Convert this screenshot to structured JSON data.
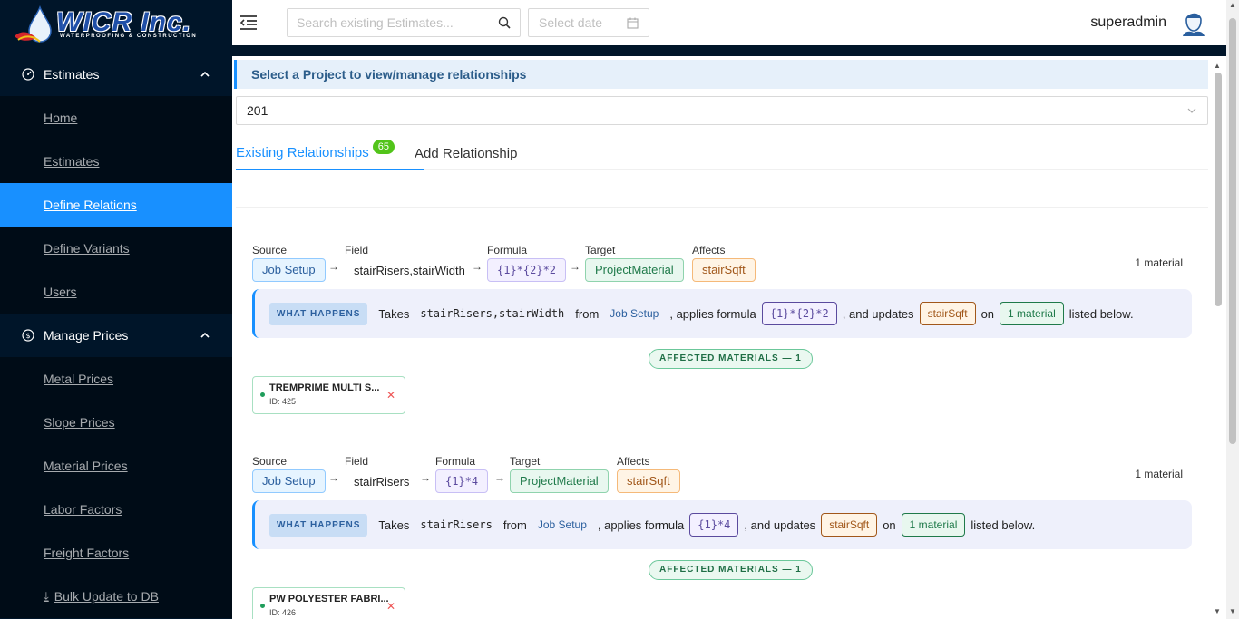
{
  "brand": {
    "logo_text": "WICR Inc.",
    "logo_sub": "WATERPROOFING & CONSTRUCTION"
  },
  "sidebar": {
    "groups": [
      {
        "label": "Estimates",
        "icon": "dashboard-icon",
        "items": [
          "Home",
          "Estimates",
          "Define Relations",
          "Define Variants",
          "Users"
        ]
      },
      {
        "label": "Manage Prices",
        "icon": "dollar-icon",
        "items": [
          "Metal Prices",
          "Slope Prices",
          "Material Prices",
          "Labor Factors",
          "Freight Factors",
          "Bulk Update to DB"
        ]
      }
    ],
    "active": "Define Relations"
  },
  "header": {
    "search_placeholder": "Search existing Estimates...",
    "date_placeholder": "Select date",
    "username": "superadmin"
  },
  "main": {
    "banner": "Select a Project to view/manage relationships",
    "project": "201",
    "tabs": {
      "existing": "Existing Relationships",
      "count": "65",
      "add": "Add Relationship"
    },
    "labels": {
      "source": "Source",
      "field": "Field",
      "formula": "Formula",
      "target": "Target",
      "affects": "Affects",
      "what_happens": "WHAT HAPPENS",
      "takes": "Takes",
      "from": "from",
      "applies": ", applies formula",
      "updates": ", and updates",
      "on": "on",
      "listed": "listed below."
    },
    "relationships": [
      {
        "source": "Job Setup",
        "field": "stairRisers,stairWidth",
        "formula": "{1}*{2}*2",
        "target": "ProjectMaterial",
        "affects": "stairSqft",
        "count": "1 material",
        "affected_label": "AFFECTED MATERIALS — 1",
        "material": {
          "name": "TREMPRIME MULTI S...",
          "id": "ID: 425"
        }
      },
      {
        "source": "Job Setup",
        "field": "stairRisers",
        "formula": "{1}*4",
        "target": "ProjectMaterial",
        "affects": "stairSqft",
        "count": "1 material",
        "affected_label": "AFFECTED MATERIALS — 1",
        "material": {
          "name": "PW POLYESTER FABRI...",
          "id": "ID: 426"
        }
      }
    ]
  },
  "colors": {
    "sidebar_bg": "#001529",
    "accent": "#1890ff",
    "badge_green": "#52c41a"
  }
}
